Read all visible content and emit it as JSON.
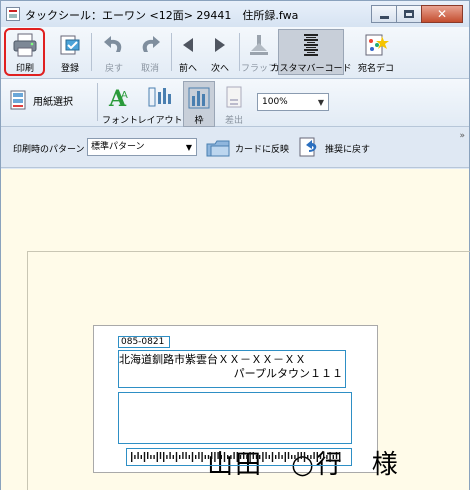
{
  "window": {
    "title": "タックシール：エーワン <12面> 29441　住所録.fwa"
  },
  "toolbar1": {
    "print": "印刷",
    "register": "登録",
    "undo": "戻す",
    "cancel": "取消",
    "prev": "前へ",
    "next": "次へ",
    "flap": "フラップ",
    "custom_barcode": "カスタマバーコード",
    "address_deco": "宛名デコ"
  },
  "toolbar2": {
    "paper_select": "用紙選択",
    "font": "フォント",
    "layout": "レイアウト",
    "frame": "枠",
    "sender": "差出",
    "zoom": "100%"
  },
  "toolbar3": {
    "pattern_label": "印刷時のパターン",
    "pattern_value": "標準パターン",
    "apply_to_card": "カードに反映",
    "restore_recommended": "推奨に戻す"
  },
  "label": {
    "postal": "085-0821",
    "address_line1": "北海道釧路市紫雲台ＸＸ－ＸＸ－ＸＸ",
    "address_line2": "パープルタウン１１１",
    "name": "山田　○行　様"
  },
  "colors": {
    "highlight": "#e02020",
    "field_border": "#2e8fc5",
    "canvas_bg": "#fffbe9"
  }
}
